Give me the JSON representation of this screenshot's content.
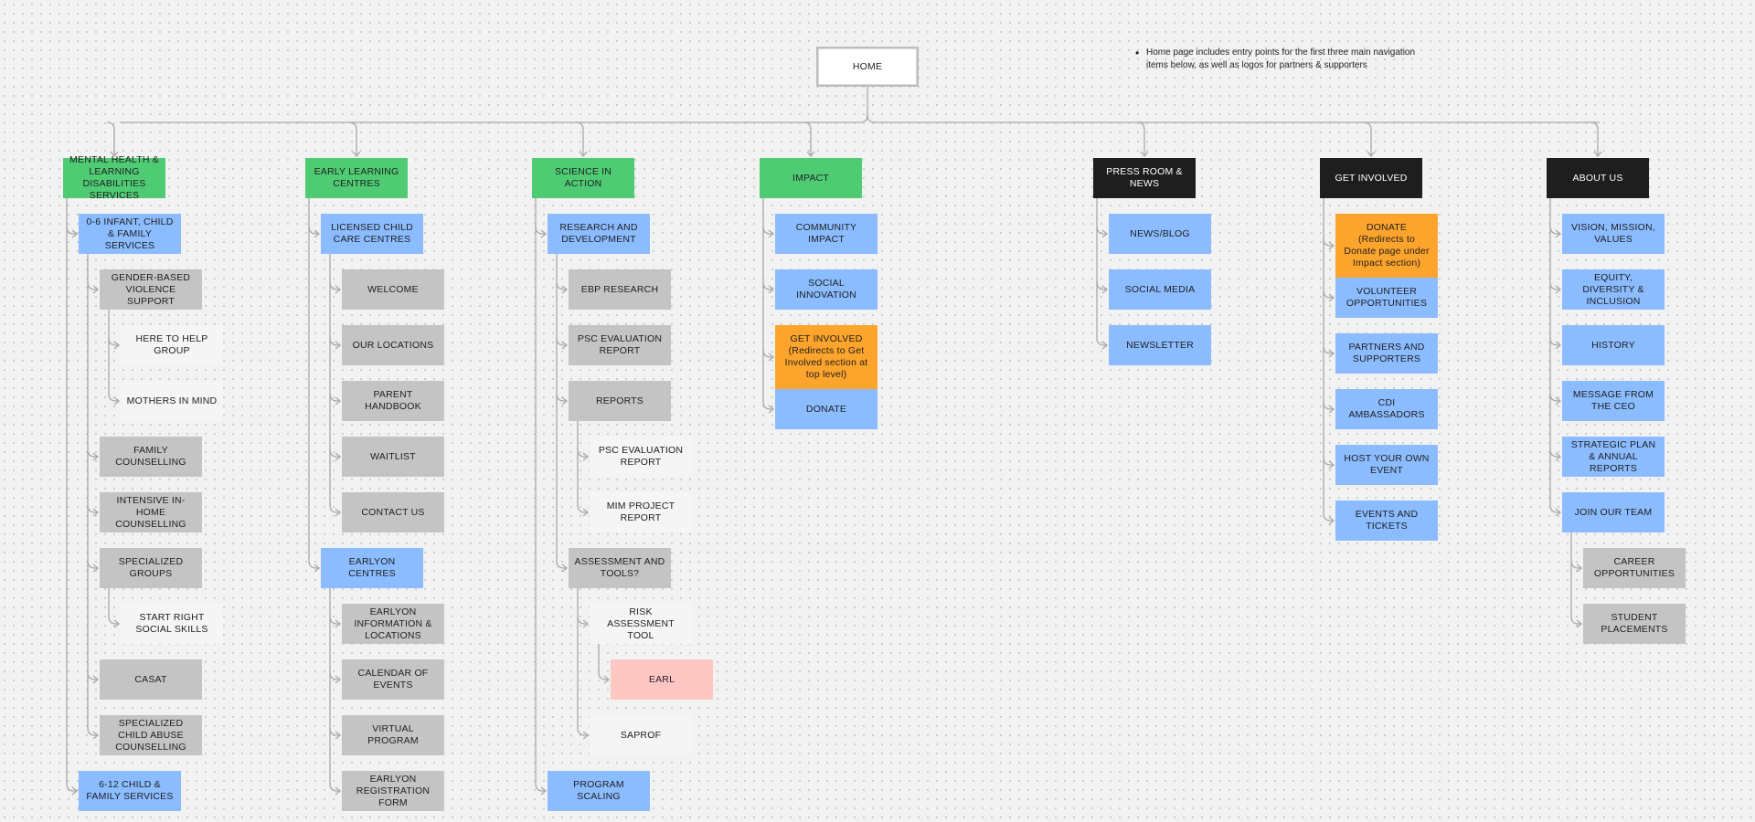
{
  "home": "HOME",
  "note": "Home page includes entry points for the first three main navigation items below, as well as logos for partners & supporters",
  "colors": {
    "green": "#4fcb74",
    "black": "#1e1e1e",
    "blue": "#8bbcff",
    "gray": "#c4c4c4",
    "light": "#f5f5f5",
    "orange": "#fda42c",
    "pink": "#ffc7c4",
    "connector": "#a9a9a9"
  },
  "columns": [
    {
      "label": "MENTAL HEALTH & LEARNING DISABILITIES SERVICES",
      "color": "green",
      "items": [
        {
          "label": "0-6 INFANT, CHILD & FAMILY SERVICES",
          "color": "blue",
          "items": [
            {
              "label": "GENDER-BASED VIOLENCE SUPPORT",
              "color": "gray",
              "items": [
                {
                  "label": "HERE TO HELP GROUP",
                  "color": "light"
                },
                {
                  "label": "MOTHERS IN MIND",
                  "color": "light"
                }
              ]
            },
            {
              "label": "FAMILY COUNSELLING",
              "color": "gray"
            },
            {
              "label": "INTENSIVE IN-HOME COUNSELLING",
              "color": "gray"
            },
            {
              "label": "SPECIALIZED GROUPS",
              "color": "gray",
              "items": [
                {
                  "label": "START RIGHT SOCIAL SKILLS",
                  "color": "light"
                }
              ]
            },
            {
              "label": "CASAT",
              "color": "gray"
            },
            {
              "label": "SPECIALIZED CHILD ABUSE COUNSELLING",
              "color": "gray"
            }
          ]
        },
        {
          "label": "6-12 CHILD & FAMILY SERVICES",
          "color": "blue"
        }
      ]
    },
    {
      "label": "EARLY LEARNING CENTRES",
      "color": "green",
      "items": [
        {
          "label": "LICENSED CHILD CARE CENTRES",
          "color": "blue",
          "items": [
            {
              "label": "WELCOME",
              "color": "gray"
            },
            {
              "label": "OUR LOCATIONS",
              "color": "gray"
            },
            {
              "label": "PARENT HANDBOOK",
              "color": "gray"
            },
            {
              "label": "WAITLIST",
              "color": "gray"
            },
            {
              "label": "CONTACT US",
              "color": "gray"
            }
          ]
        },
        {
          "label": "EARLYON CENTRES",
          "color": "blue",
          "items": [
            {
              "label": "EARLYON INFORMATION & LOCATIONS",
              "color": "gray"
            },
            {
              "label": "CALENDAR OF EVENTS",
              "color": "gray"
            },
            {
              "label": "VIRTUAL PROGRAM",
              "color": "gray"
            },
            {
              "label": "EARLYON REGISTRATION FORM",
              "color": "gray"
            }
          ]
        }
      ]
    },
    {
      "label": "SCIENCE IN ACTION",
      "color": "green",
      "items": [
        {
          "label": "RESEARCH AND DEVELOPMENT",
          "color": "blue",
          "items": [
            {
              "label": "EBP RESEARCH",
              "color": "gray"
            },
            {
              "label": "PSC EVALUATION REPORT",
              "color": "gray"
            },
            {
              "label": "REPORTS",
              "color": "gray",
              "items": [
                {
                  "label": "PSC EVALUATION REPORT",
                  "color": "light"
                },
                {
                  "label": "MIM PROJECT REPORT",
                  "color": "light"
                }
              ]
            },
            {
              "label": "ASSESSMENT AND TOOLS?",
              "color": "gray",
              "items": [
                {
                  "label": "RISK ASSESSMENT TOOL",
                  "color": "light",
                  "items": [
                    {
                      "label": "EARL",
                      "color": "pink"
                    }
                  ]
                },
                {
                  "label": "SAPROF",
                  "color": "light"
                }
              ]
            }
          ]
        },
        {
          "label": "PROGRAM SCALING",
          "color": "blue"
        }
      ]
    },
    {
      "label": "IMPACT",
      "color": "green",
      "items": [
        {
          "label": "COMMUNITY IMPACT",
          "color": "blue"
        },
        {
          "label": "SOCIAL INNOVATION",
          "color": "blue"
        },
        {
          "label": "GET INVOLVED\n(Redirects to Get Involved section at top level)",
          "color": "orange"
        },
        {
          "label": "DONATE",
          "color": "blue"
        }
      ]
    },
    {
      "label": "PRESS ROOM & NEWS",
      "color": "black",
      "items": [
        {
          "label": "NEWS/BLOG",
          "color": "blue"
        },
        {
          "label": "SOCIAL MEDIA",
          "color": "blue"
        },
        {
          "label": "NEWSLETTER",
          "color": "blue"
        }
      ]
    },
    {
      "label": "GET INVOLVED",
      "color": "black",
      "items": [
        {
          "label": "DONATE\n(Redirects to Donate page under Impact section)",
          "color": "orange"
        },
        {
          "label": "VOLUNTEER OPPORTUNITIES",
          "color": "blue"
        },
        {
          "label": "PARTNERS AND SUPPORTERS",
          "color": "blue"
        },
        {
          "label": "CDI AMBASSADORS",
          "color": "blue"
        },
        {
          "label": "HOST YOUR OWN EVENT",
          "color": "blue"
        },
        {
          "label": "EVENTS AND TICKETS",
          "color": "blue"
        }
      ]
    },
    {
      "label": "ABOUT US",
      "color": "black",
      "items": [
        {
          "label": "VISION, MISSION, VALUES",
          "color": "blue"
        },
        {
          "label": "EQUITY, DIVERSITY & INCLUSION",
          "color": "blue"
        },
        {
          "label": "HISTORY",
          "color": "blue"
        },
        {
          "label": "MESSAGE FROM THE CEO",
          "color": "blue"
        },
        {
          "label": "STRATEGIC PLAN & ANNUAL REPORTS",
          "color": "blue"
        },
        {
          "label": "JOIN OUR TEAM",
          "color": "blue",
          "items": [
            {
              "label": "CAREER OPPORTUNITIES",
              "color": "gray"
            },
            {
              "label": "STUDENT PLACEMENTS",
              "color": "gray"
            }
          ]
        }
      ]
    }
  ]
}
